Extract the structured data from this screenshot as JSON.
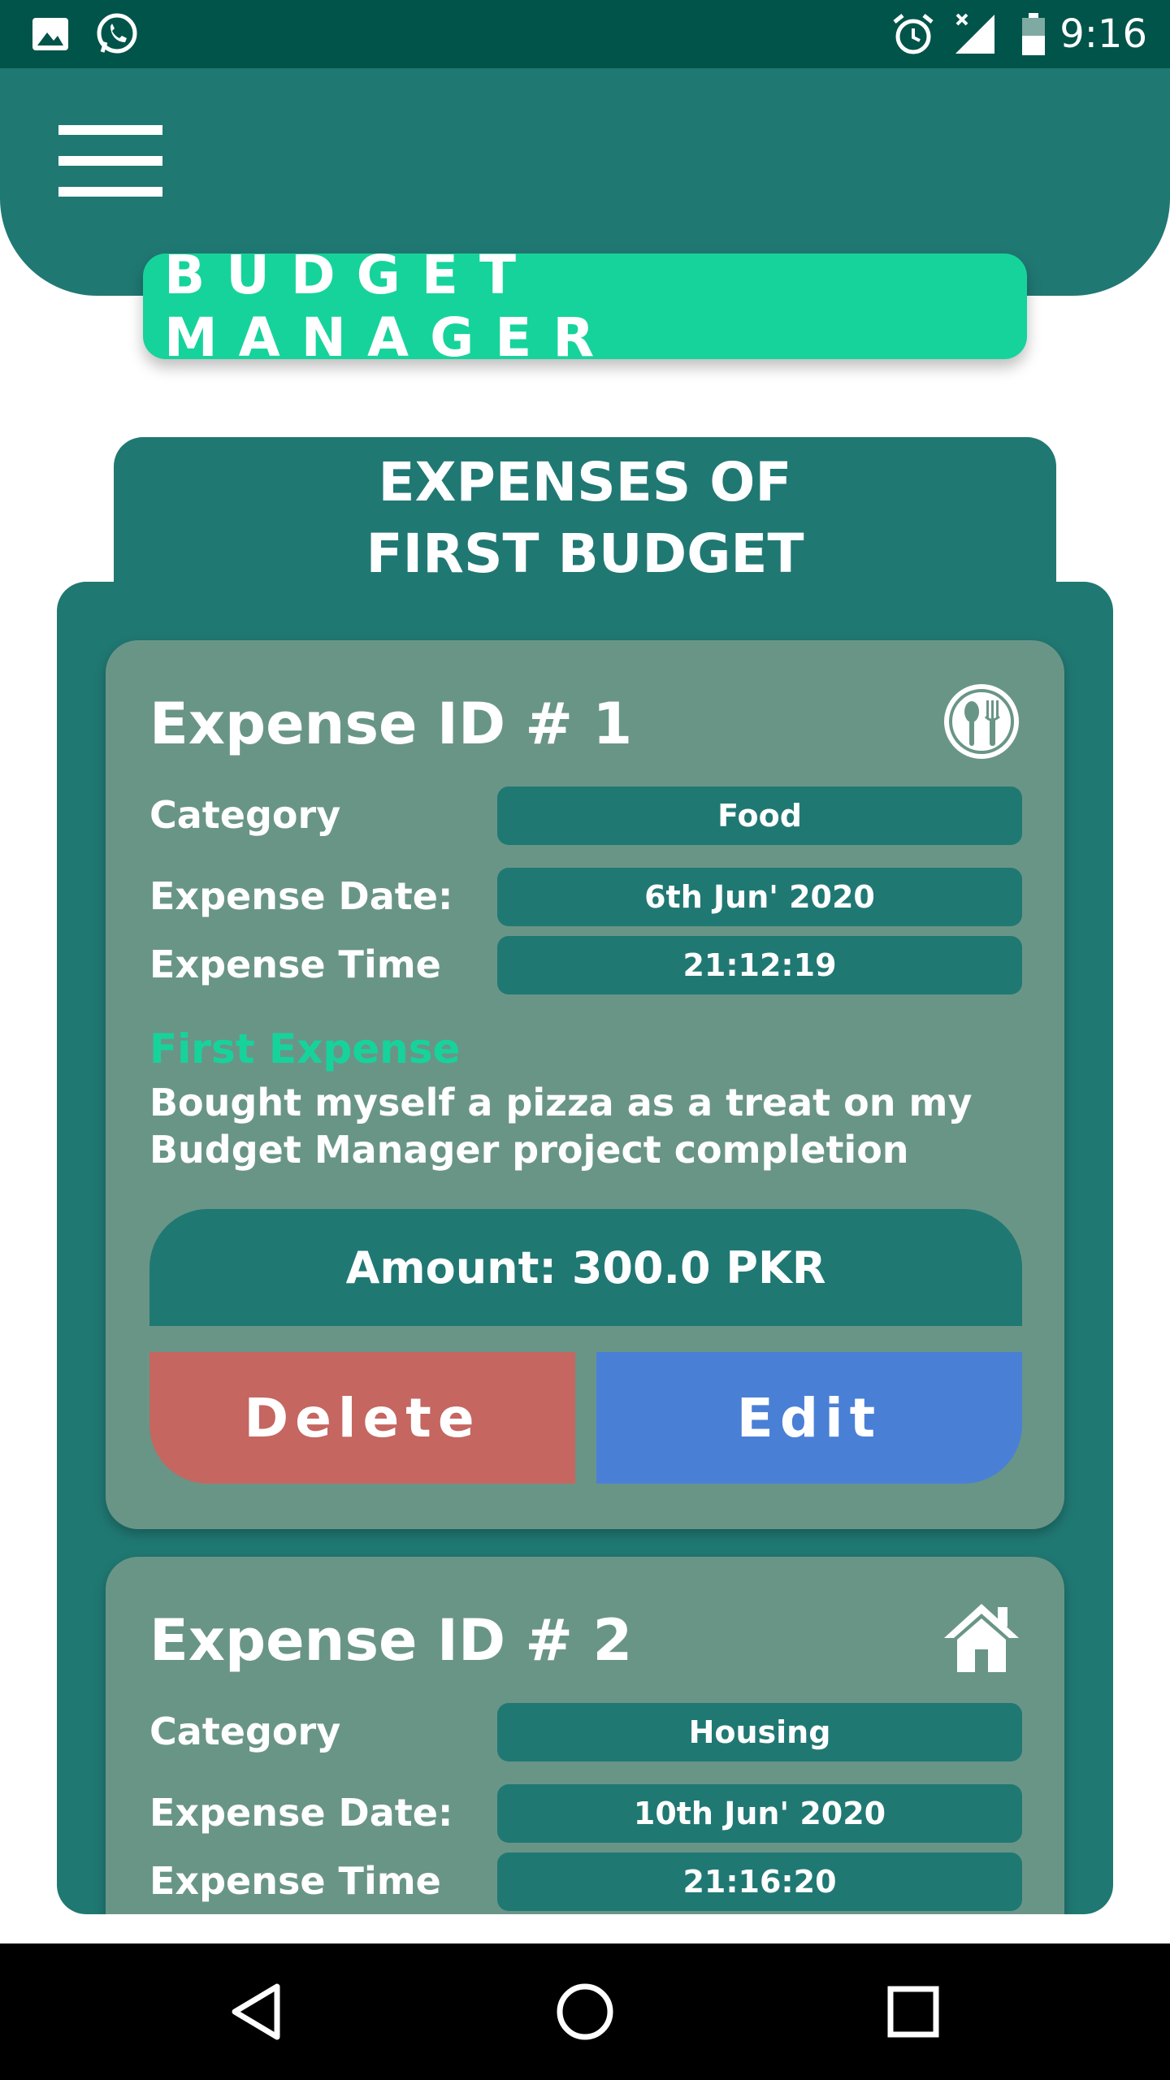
{
  "status_bar": {
    "time": "9:16",
    "icons": [
      "image-icon",
      "whatsapp-icon",
      "alarm-icon",
      "signal-icon",
      "battery-icon"
    ]
  },
  "app": {
    "title": "BUDGET MANAGER",
    "section_title_line1": "EXPENSES OF",
    "section_title_line2": "FIRST BUDGET"
  },
  "expenses": [
    {
      "title": "Expense ID # 1",
      "icon": "food-icon",
      "category_label": "Category",
      "category": "Food",
      "date_label": "Expense Date:",
      "date": "6th Jun' 2020",
      "time_label": "Expense Time",
      "time": "21:12:19",
      "note_title": "First Expense",
      "note_body": "Bought myself a pizza as a treat on my Budget Manager project completion",
      "amount": "Amount: 300.0 PKR",
      "delete_label": "Delete",
      "edit_label": "Edit"
    },
    {
      "title": "Expense ID # 2",
      "icon": "home-icon",
      "category_label": "Category",
      "category": "Housing",
      "date_label": "Expense Date:",
      "date": "10th Jun' 2020",
      "time_label": "Expense Time",
      "time": "21:16:20"
    }
  ],
  "colors": {
    "status_bar": "#00544a",
    "primary": "#207873",
    "accent": "#16d39c",
    "card": "#699587",
    "delete": "#c56660",
    "edit": "#4a7fd6"
  },
  "nav": [
    "back-icon",
    "home-circle-icon",
    "recents-icon"
  ]
}
